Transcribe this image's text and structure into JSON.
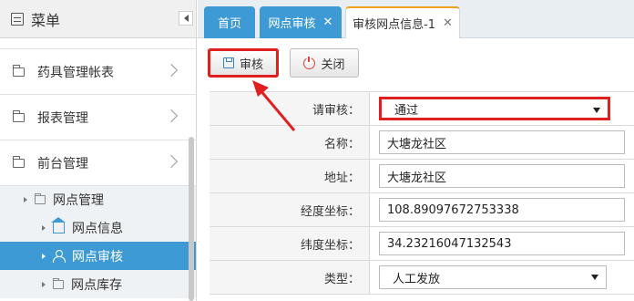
{
  "sidebar": {
    "title": "菜单",
    "items": [
      {
        "label": "药具管理帐表"
      },
      {
        "label": "报表管理"
      },
      {
        "label": "前台管理"
      }
    ],
    "submenu": {
      "group_label": "网点管理",
      "children": [
        {
          "label": "网点信息",
          "active": false
        },
        {
          "label": "网点审核",
          "active": true
        },
        {
          "label": "网点库存",
          "active": false
        }
      ]
    }
  },
  "tabs": [
    {
      "label": "首页",
      "closable": false
    },
    {
      "label": "网点审核",
      "closable": true
    },
    {
      "label": "审核网点信息-1",
      "closable": true,
      "current": true
    }
  ],
  "toolbar": {
    "save_label": "审核",
    "close_label": "关闭"
  },
  "form": {
    "review": {
      "label": "请审核：",
      "value": "通过"
    },
    "name": {
      "label": "名称：",
      "value": "大塘龙社区"
    },
    "address": {
      "label": "地址：",
      "value": "大塘龙社区"
    },
    "longitude": {
      "label": "经度坐标：",
      "value": "108.89097672753338"
    },
    "latitude": {
      "label": "纬度坐标：",
      "value": "34.23216047132543"
    },
    "type": {
      "label": "类型：",
      "value": "人工发放"
    }
  },
  "colors": {
    "accent": "#3d9ad4",
    "highlight": "#e02020",
    "active_tab_border": "#f0a020"
  }
}
